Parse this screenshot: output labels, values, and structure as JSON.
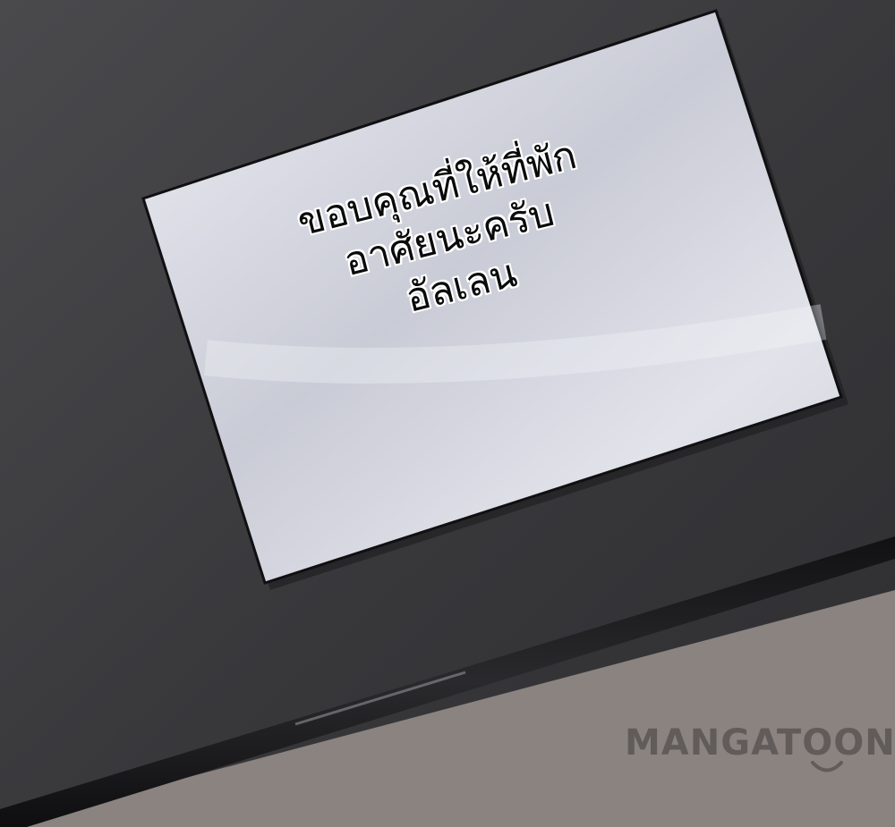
{
  "note": {
    "lines": [
      "ขอบคุณที่ให้ที่พัก",
      "อาศัยนะครับ",
      "อัลเลน"
    ]
  },
  "watermark": {
    "text": "MANGATOON"
  },
  "colors": {
    "wall": "#3a3a3c",
    "floor": "#8a8380",
    "paper": "#d8d9e2",
    "ledge": "#1a1a1c"
  }
}
